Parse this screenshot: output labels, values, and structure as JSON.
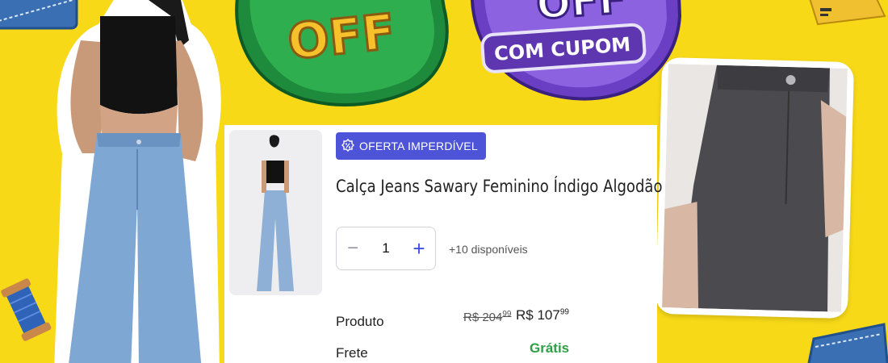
{
  "badges": {
    "green_big": "OFF",
    "purple_big": "OFF",
    "purple_sub": "COM CUPOM"
  },
  "product": {
    "deal_tag": "OFERTA IMPERDÍVEL",
    "title": "Calça Jeans Sawary Feminino Índigo Algodão",
    "quantity": "1",
    "availability": "+10 disponíveis",
    "rows": {
      "product_label": "Produto",
      "shipping_label": "Frete"
    },
    "old_price_text": "R$ 204",
    "old_price_cents": "99",
    "new_price_text": "R$ 107",
    "new_price_cents": "99",
    "shipping_value": "Grátis"
  },
  "colors": {
    "background": "#f7d917",
    "deal_tag": "#4d54d8",
    "free_shipping": "#2f9e44",
    "badge_green": "#1e8a3c",
    "badge_purple": "#6a3fc4"
  }
}
